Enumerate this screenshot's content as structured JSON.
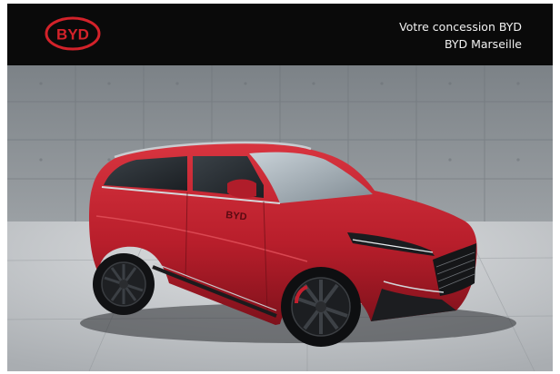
{
  "header": {
    "logo_text": "BYD",
    "dealer_line1": "Votre concession BYD",
    "dealer_line2": "BYD Marseille"
  },
  "photo": {
    "subject": "car-image",
    "car_badge": "BYD"
  },
  "colors": {
    "header_bg": "#0a0a0a",
    "logo_red": "#d3222a",
    "car_red": "#b81e2b",
    "wall_gray": "#8d9296"
  }
}
